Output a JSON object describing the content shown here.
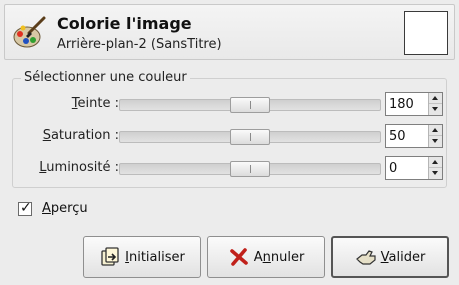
{
  "header": {
    "title": "Colorie l'image",
    "subtitle": "Arrière-plan-2 (SansTitre)",
    "icon": "colorize-brush-icon"
  },
  "group": {
    "legend": "Sélectionner une couleur",
    "rows": [
      {
        "label_first": "T",
        "label_rest": "einte :",
        "value": "180",
        "min": 0,
        "max": 360
      },
      {
        "label_first": "S",
        "label_rest": "aturation :",
        "value": "50",
        "min": 0,
        "max": 100
      },
      {
        "label_first": "L",
        "label_rest": "uminosité :",
        "value": "0",
        "min": -100,
        "max": 100
      }
    ]
  },
  "preview": {
    "label_first": "A",
    "label_rest": "perçu",
    "checked": true,
    "check_glyph": "✓"
  },
  "buttons": {
    "reset": {
      "first": "I",
      "rest": "nitialiser",
      "icon": "reset-icon"
    },
    "cancel": {
      "pre": "A",
      "first": "n",
      "rest": "nuler",
      "icon": "cancel-x-icon",
      "color": "#c0201a"
    },
    "ok": {
      "first": "V",
      "rest": "alider",
      "icon": "ok-hand-icon"
    }
  }
}
